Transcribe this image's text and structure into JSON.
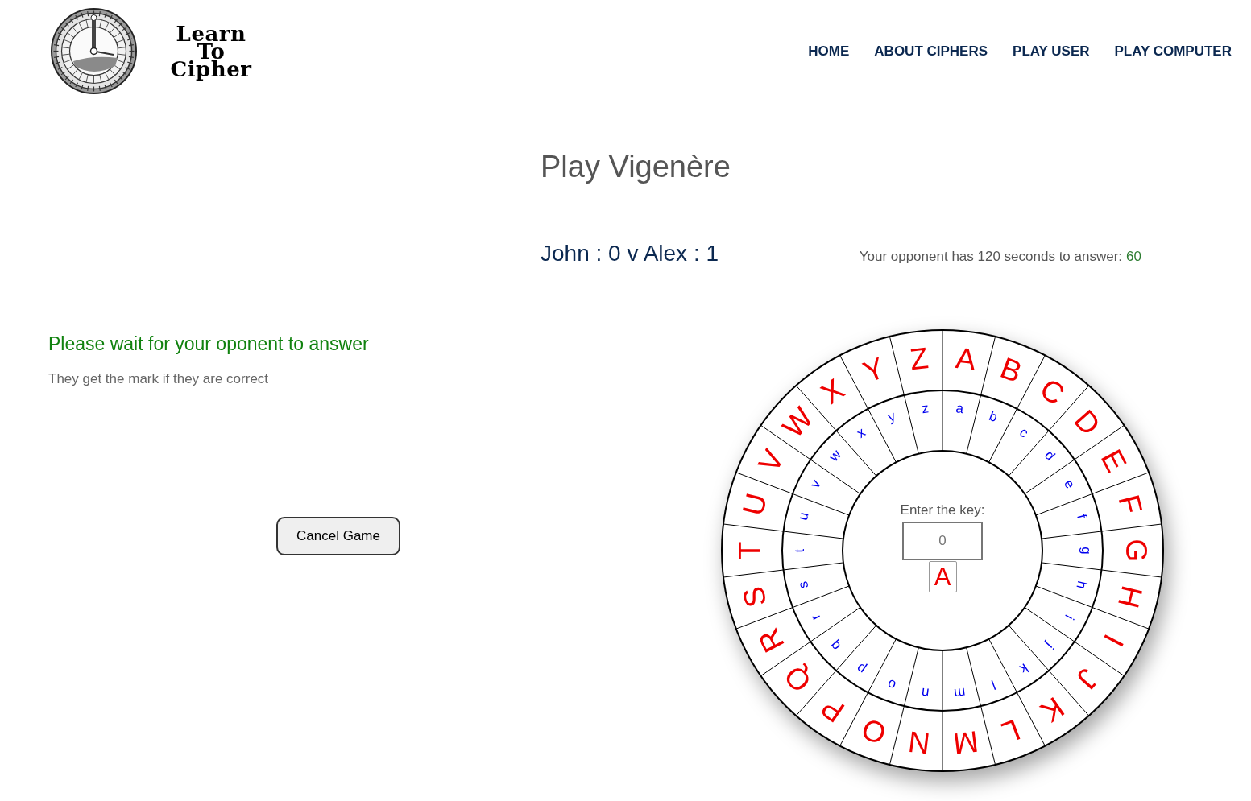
{
  "logo": {
    "lines": [
      "Learn",
      "To",
      "Cipher"
    ]
  },
  "nav": [
    "HOME",
    "ABOUT CIPHERS",
    "PLAY USER",
    "PLAY COMPUTER"
  ],
  "page_title": "Play Vigenère",
  "score": "John : 0 v Alex : 1",
  "timer": {
    "label": "Your opponent has 120 seconds to answer:",
    "seconds": "60"
  },
  "status": {
    "message": "Please wait for your oponent to answer",
    "note": "They get the mark if they are correct"
  },
  "cancel_button": "Cancel Game",
  "wheel": {
    "outer_letters": [
      "A",
      "B",
      "C",
      "D",
      "E",
      "F",
      "G",
      "H",
      "I",
      "J",
      "K",
      "L",
      "M",
      "N",
      "O",
      "P",
      "Q",
      "R",
      "S",
      "T",
      "U",
      "V",
      "W",
      "X",
      "Y",
      "Z"
    ],
    "inner_letters": [
      "a",
      "b",
      "c",
      "d",
      "e",
      "f",
      "g",
      "h",
      "i",
      "j",
      "k",
      "l",
      "m",
      "n",
      "o",
      "p",
      "q",
      "r",
      "s",
      "t",
      "u",
      "v",
      "w",
      "x",
      "y",
      "z"
    ],
    "key_label": "Enter the key:",
    "key_input": {
      "placeholder": "0"
    },
    "key_letter": "A"
  }
}
